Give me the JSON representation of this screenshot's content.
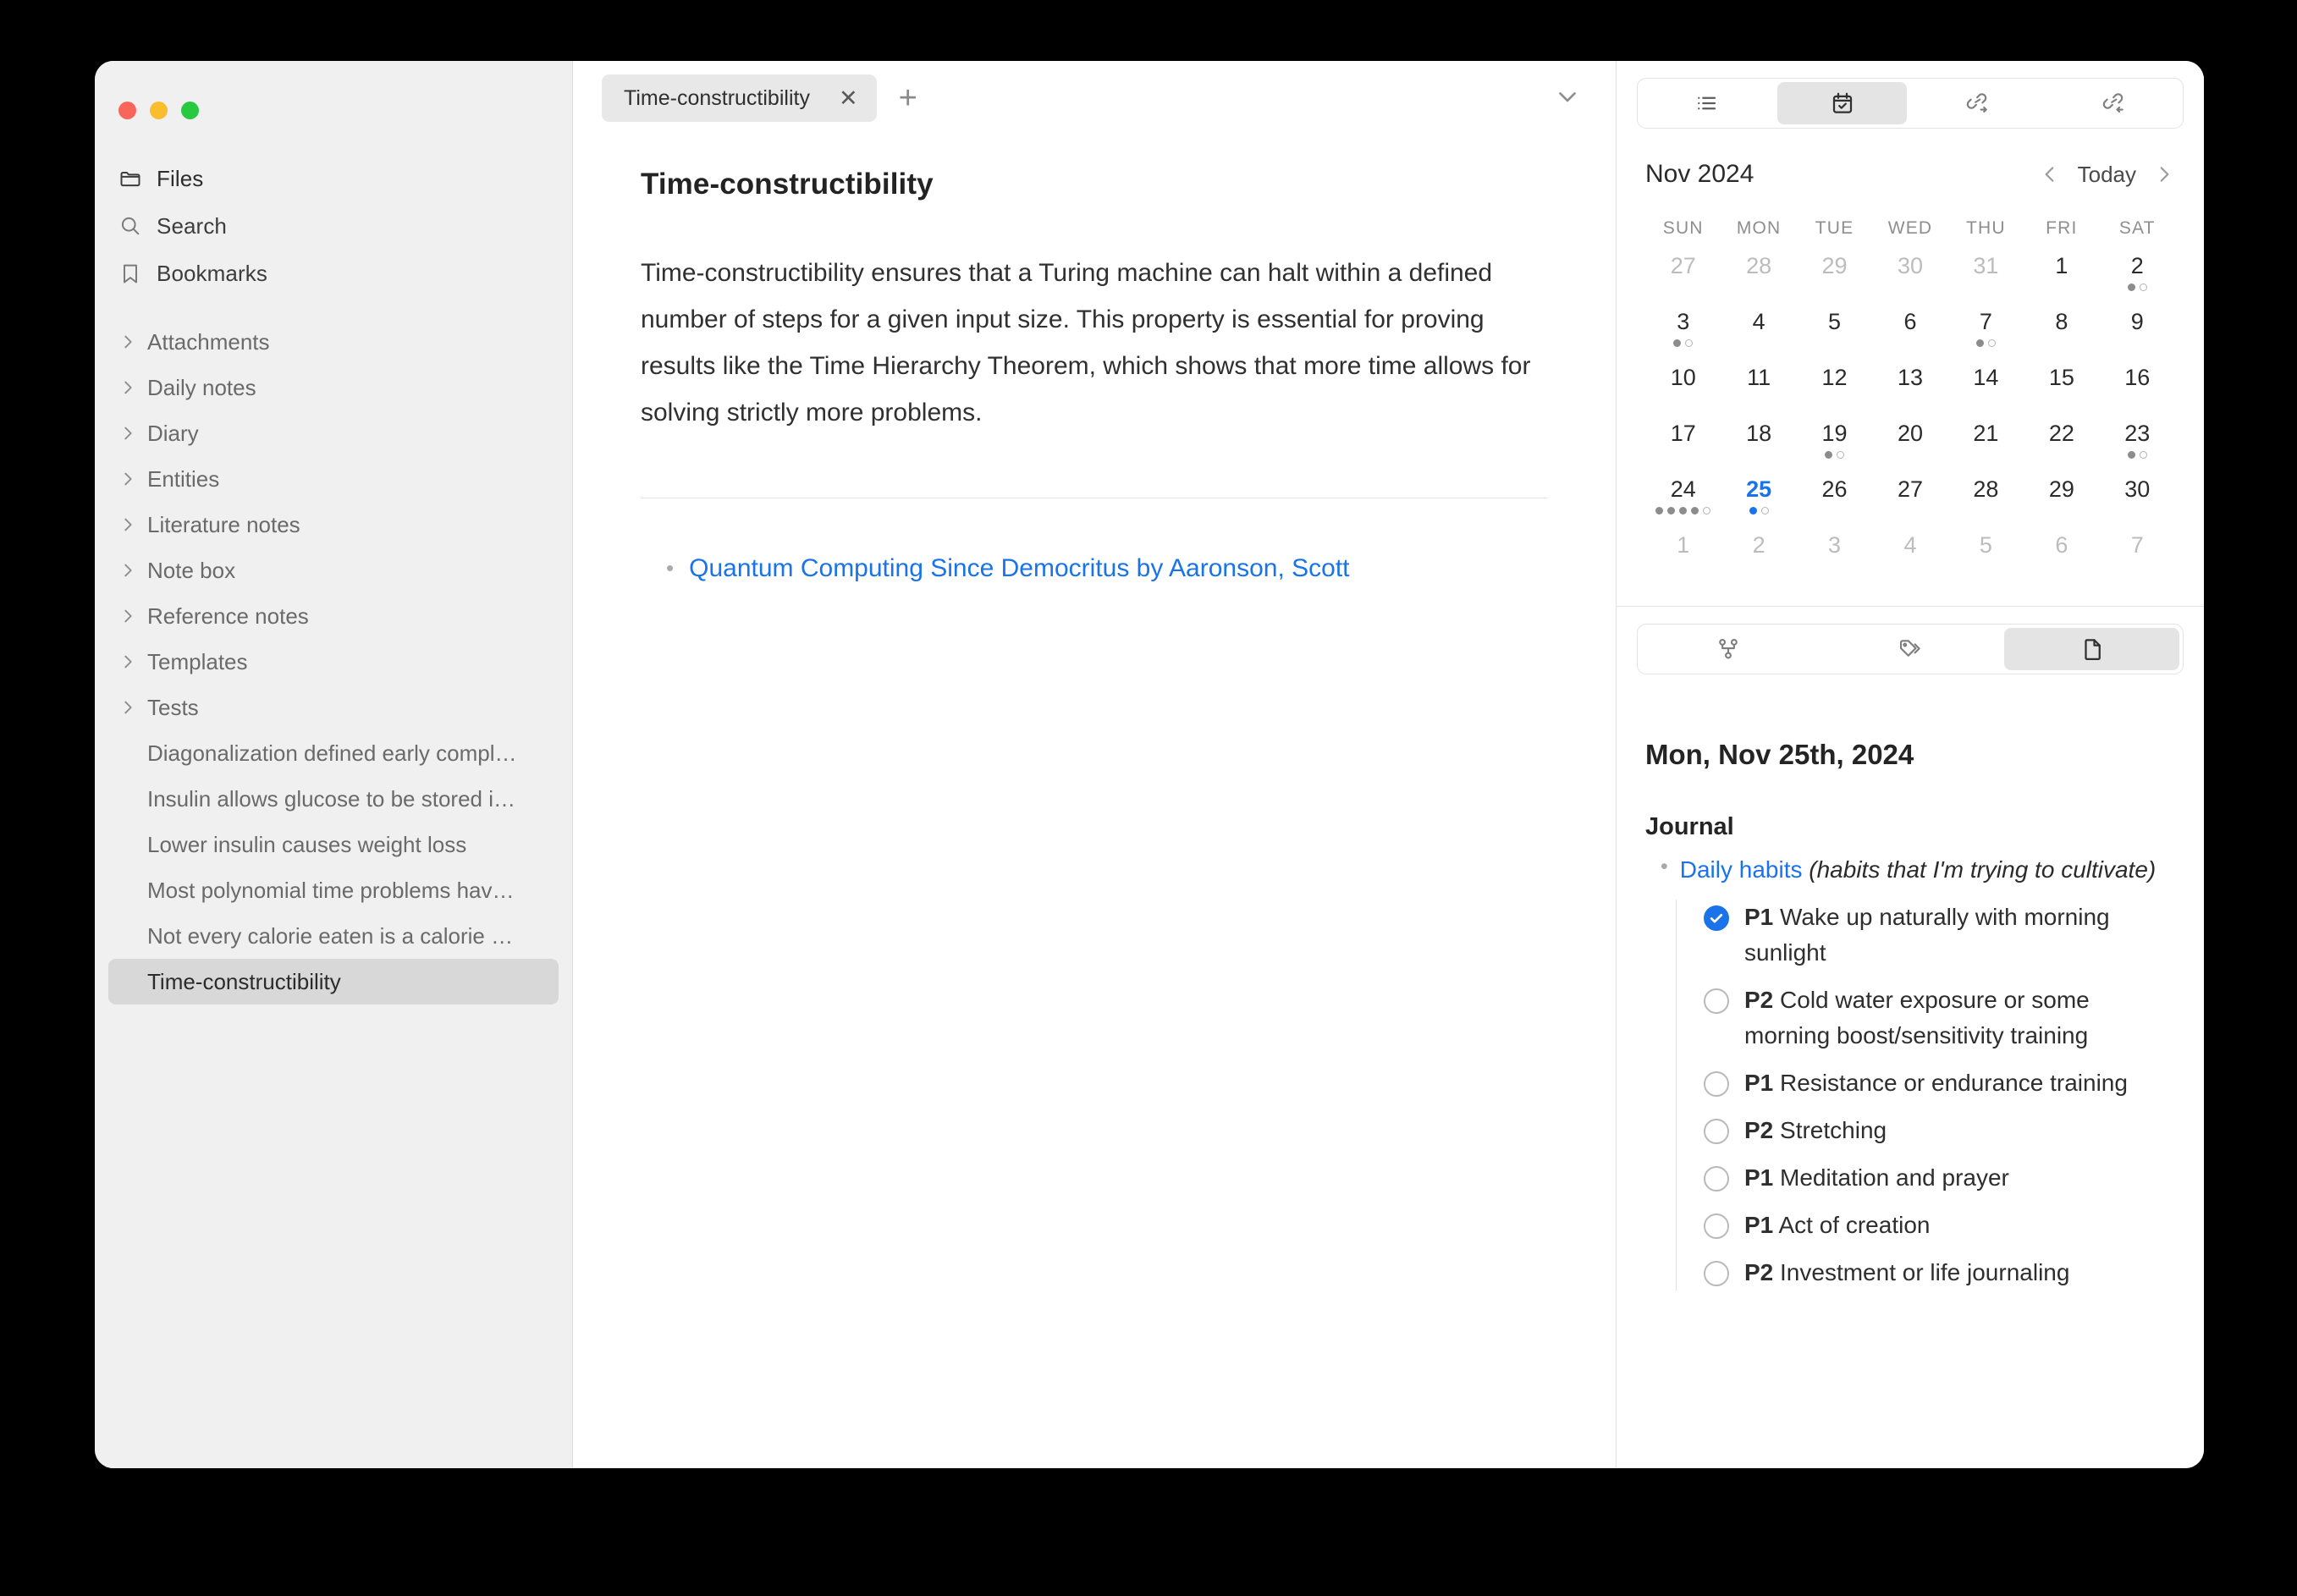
{
  "window": {
    "traffic_lights": [
      "close",
      "minimize",
      "zoom"
    ]
  },
  "sidebar": {
    "primary_items": [
      {
        "label": "Files",
        "icon": "folder-icon"
      },
      {
        "label": "Search",
        "icon": "search-icon"
      },
      {
        "label": "Bookmarks",
        "icon": "bookmark-icon"
      }
    ],
    "folders": [
      {
        "label": "Attachments"
      },
      {
        "label": "Daily notes"
      },
      {
        "label": "Diary"
      },
      {
        "label": "Entities"
      },
      {
        "label": "Literature notes"
      },
      {
        "label": "Note box"
      },
      {
        "label": "Reference notes"
      },
      {
        "label": "Templates"
      },
      {
        "label": "Tests"
      }
    ],
    "files": [
      {
        "label": "Diagonalization defined early compl…",
        "selected": false
      },
      {
        "label": "Insulin allows glucose to be stored i…",
        "selected": false
      },
      {
        "label": "Lower insulin causes weight loss",
        "selected": false
      },
      {
        "label": "Most polynomial time problems hav…",
        "selected": false
      },
      {
        "label": "Not every calorie eaten is a calorie …",
        "selected": false
      },
      {
        "label": "Time-constructibility",
        "selected": true
      }
    ]
  },
  "editor": {
    "tabs": [
      {
        "label": "Time-constructibility",
        "close_label": "✕",
        "active": true
      }
    ],
    "new_tab_label": "+",
    "overflow_icon": "chevron-down-icon",
    "document": {
      "title": "Time-constructibility",
      "paragraph": "Time-constructibility ensures that a Turing machine can halt within a defined number of steps for a given input size. This property is essential for proving results like the Time Hierarchy Theorem, which shows that more time allows for solving strictly more problems.",
      "references": [
        {
          "text": "Quantum Computing Since Democritus by Aaronson, Scott"
        }
      ]
    }
  },
  "right_panel": {
    "top_tabs": [
      {
        "icon": "list-icon",
        "active": false
      },
      {
        "icon": "calendar-check-icon",
        "active": true
      },
      {
        "icon": "outgoing-links-icon",
        "active": false
      },
      {
        "icon": "incoming-links-icon",
        "active": false
      }
    ],
    "calendar": {
      "month_label": "Nov 2024",
      "today_label": "Today",
      "prev_icon": "chevron-left-icon",
      "next_icon": "chevron-right-icon",
      "weekday_headers": [
        "SUN",
        "MON",
        "TUE",
        "WED",
        "THU",
        "FRI",
        "SAT"
      ],
      "weeks": [
        [
          {
            "day": "27",
            "muted": true,
            "dots": []
          },
          {
            "day": "28",
            "muted": true,
            "dots": []
          },
          {
            "day": "29",
            "muted": true,
            "dots": []
          },
          {
            "day": "30",
            "muted": true,
            "dots": []
          },
          {
            "day": "31",
            "muted": true,
            "dots": []
          },
          {
            "day": "1",
            "muted": false,
            "dots": []
          },
          {
            "day": "2",
            "muted": false,
            "dots": [
              "filled",
              "hollow"
            ]
          }
        ],
        [
          {
            "day": "3",
            "muted": false,
            "dots": [
              "filled",
              "hollow"
            ]
          },
          {
            "day": "4",
            "muted": false,
            "dots": []
          },
          {
            "day": "5",
            "muted": false,
            "dots": []
          },
          {
            "day": "6",
            "muted": false,
            "dots": []
          },
          {
            "day": "7",
            "muted": false,
            "dots": [
              "filled",
              "hollow"
            ]
          },
          {
            "day": "8",
            "muted": false,
            "dots": []
          },
          {
            "day": "9",
            "muted": false,
            "dots": []
          }
        ],
        [
          {
            "day": "10",
            "muted": false,
            "dots": []
          },
          {
            "day": "11",
            "muted": false,
            "dots": []
          },
          {
            "day": "12",
            "muted": false,
            "dots": []
          },
          {
            "day": "13",
            "muted": false,
            "dots": []
          },
          {
            "day": "14",
            "muted": false,
            "dots": []
          },
          {
            "day": "15",
            "muted": false,
            "dots": []
          },
          {
            "day": "16",
            "muted": false,
            "dots": []
          }
        ],
        [
          {
            "day": "17",
            "muted": false,
            "dots": []
          },
          {
            "day": "18",
            "muted": false,
            "dots": []
          },
          {
            "day": "19",
            "muted": false,
            "dots": [
              "filled",
              "hollow"
            ]
          },
          {
            "day": "20",
            "muted": false,
            "dots": []
          },
          {
            "day": "21",
            "muted": false,
            "dots": []
          },
          {
            "day": "22",
            "muted": false,
            "dots": []
          },
          {
            "day": "23",
            "muted": false,
            "dots": [
              "filled",
              "hollow"
            ]
          }
        ],
        [
          {
            "day": "24",
            "muted": false,
            "dots": [
              "filled",
              "filled",
              "filled",
              "filled",
              "hollow"
            ]
          },
          {
            "day": "25",
            "muted": false,
            "today": true,
            "dots": [
              "blue",
              "hollow"
            ]
          },
          {
            "day": "26",
            "muted": false,
            "dots": []
          },
          {
            "day": "27",
            "muted": false,
            "dots": []
          },
          {
            "day": "28",
            "muted": false,
            "dots": []
          },
          {
            "day": "29",
            "muted": false,
            "dots": []
          },
          {
            "day": "30",
            "muted": false,
            "dots": []
          }
        ],
        [
          {
            "day": "1",
            "muted": true,
            "dots": []
          },
          {
            "day": "2",
            "muted": true,
            "dots": []
          },
          {
            "day": "3",
            "muted": true,
            "dots": []
          },
          {
            "day": "4",
            "muted": true,
            "dots": []
          },
          {
            "day": "5",
            "muted": true,
            "dots": []
          },
          {
            "day": "6",
            "muted": true,
            "dots": []
          },
          {
            "day": "7",
            "muted": true,
            "dots": []
          }
        ]
      ]
    },
    "bottom_tabs": [
      {
        "icon": "graph-icon",
        "active": false
      },
      {
        "icon": "tags-icon",
        "active": false
      },
      {
        "icon": "document-icon",
        "active": true
      }
    ],
    "journal": {
      "date_heading": "Mon, Nov 25th, 2024",
      "section_title": "Journal",
      "entry_link": "Daily habits",
      "entry_note": "(habits that I'm trying to cultivate)",
      "tasks": [
        {
          "priority": "P1",
          "text": "Wake up naturally with morning sunlight",
          "checked": true
        },
        {
          "priority": "P2",
          "text": "Cold water exposure or some morning boost/sensitivity training",
          "checked": false
        },
        {
          "priority": "P1",
          "text": "Resistance or endurance training",
          "checked": false
        },
        {
          "priority": "P2",
          "text": "Stretching",
          "checked": false
        },
        {
          "priority": "P1",
          "text": "Meditation and prayer",
          "checked": false
        },
        {
          "priority": "P1",
          "text": "Act of creation",
          "checked": false
        },
        {
          "priority": "P2",
          "text": "Investment or life journaling",
          "checked": false
        }
      ]
    }
  },
  "colors": {
    "accent_blue": "#1a73e8",
    "sidebar_bg": "#f0f0f0",
    "selected_row": "#d8d8d8",
    "traffic_red": "#f9655b",
    "traffic_yellow": "#f9bd2e",
    "traffic_green": "#28c840"
  }
}
